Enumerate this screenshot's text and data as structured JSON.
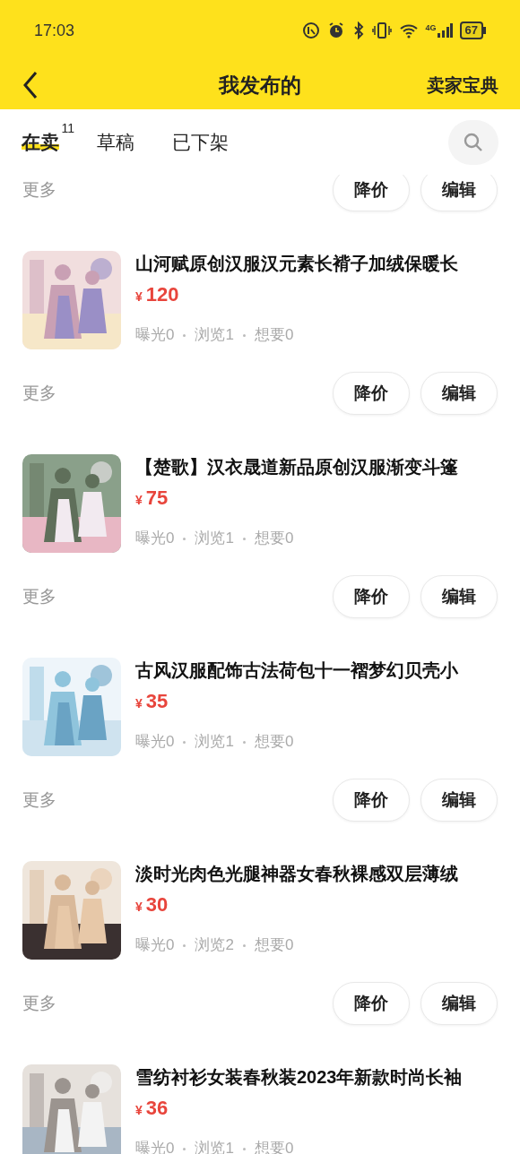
{
  "status_bar": {
    "time": "17:03",
    "network": "4G",
    "battery": "67"
  },
  "header": {
    "title": "我发布的",
    "action": "卖家宝典"
  },
  "tabs": [
    {
      "label": "在卖",
      "count": "11",
      "selected": true
    },
    {
      "label": "草稿",
      "selected": false
    },
    {
      "label": "已下架",
      "selected": false
    }
  ],
  "partial_actions": {
    "more": "更多",
    "buttons": [
      "降价",
      "编辑"
    ]
  },
  "items": [
    {
      "title": "山河赋原创汉服汉元素长褙子加绒保暖长",
      "currency": "¥",
      "price": "120",
      "stats": [
        "曝光0",
        "浏览1",
        "想要0"
      ],
      "more": "更多",
      "buttons": [
        "降价",
        "编辑"
      ]
    },
    {
      "title": "【楚歌】汉衣晟道新品原创汉服渐变斗篷",
      "currency": "¥",
      "price": "75",
      "stats": [
        "曝光0",
        "浏览1",
        "想要0"
      ],
      "more": "更多",
      "buttons": [
        "降价",
        "编辑"
      ]
    },
    {
      "title": "古风汉服配饰古法荷包十一褶梦幻贝壳小",
      "currency": "¥",
      "price": "35",
      "stats": [
        "曝光0",
        "浏览1",
        "想要0"
      ],
      "more": "更多",
      "buttons": [
        "降价",
        "编辑"
      ]
    },
    {
      "title": "淡时光肉色光腿神器女春秋裸感双层薄绒",
      "currency": "¥",
      "price": "30",
      "stats": [
        "曝光0",
        "浏览2",
        "想要0"
      ],
      "more": "更多",
      "buttons": [
        "降价",
        "编辑"
      ]
    },
    {
      "title": "雪纺衬衫女装春秋装2023年新款时尚长袖",
      "currency": "¥",
      "price": "36",
      "stats": [
        "曝光0",
        "浏览1",
        "想要0"
      ]
    }
  ]
}
